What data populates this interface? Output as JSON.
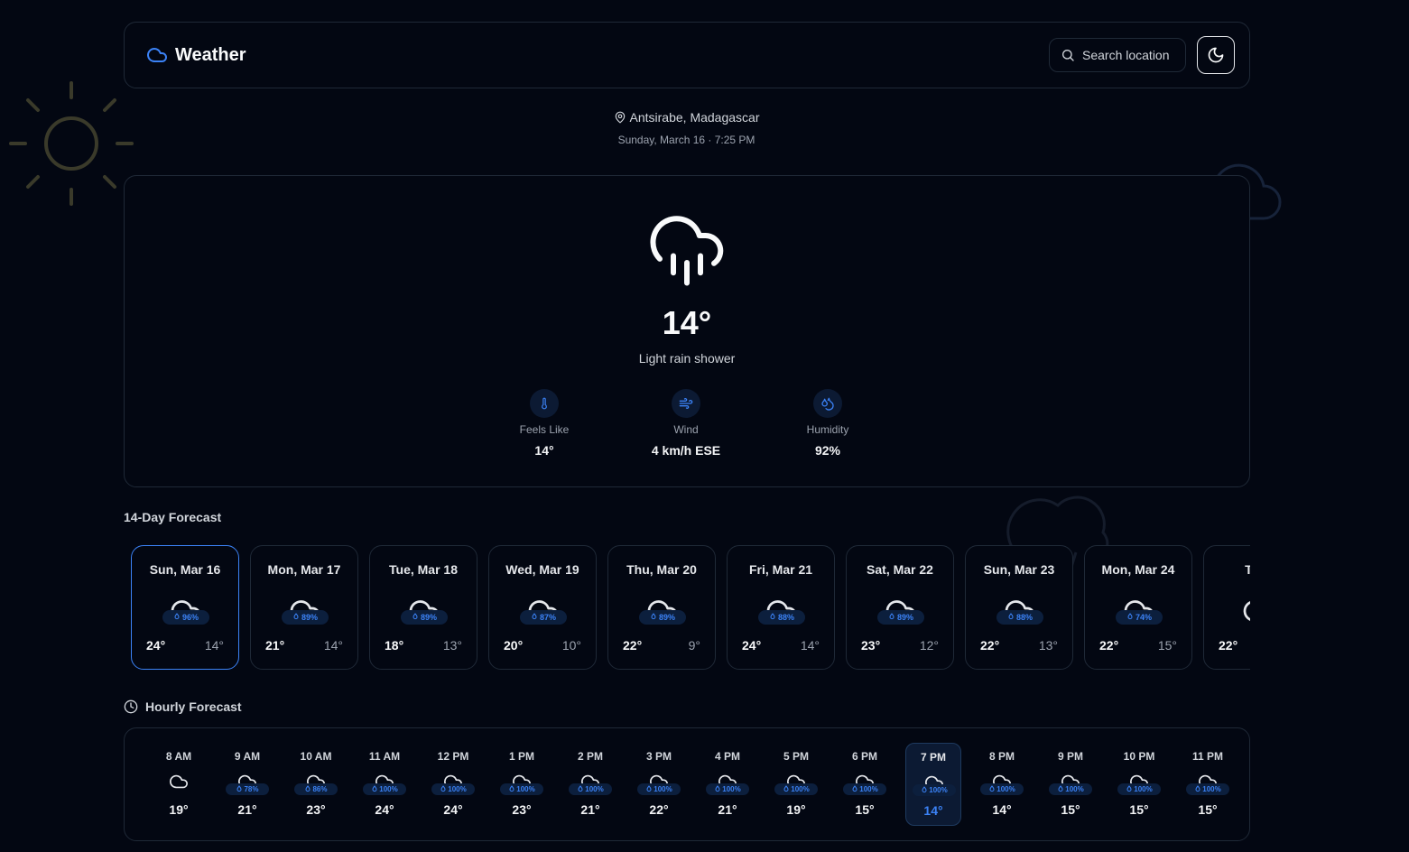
{
  "header": {
    "title": "Weather",
    "search_label": "Search location"
  },
  "location": {
    "name": "Antsirabe, Madagascar",
    "datetime": "Sunday, March 16 · 7:25 PM"
  },
  "current": {
    "temperature": "14°",
    "condition": "Light rain shower",
    "stats": [
      {
        "label": "Feels Like",
        "value": "14°",
        "icon": "thermometer-icon"
      },
      {
        "label": "Wind",
        "value": "4 km/h ESE",
        "icon": "wind-icon"
      },
      {
        "label": "Humidity",
        "value": "92%",
        "icon": "droplets-icon"
      }
    ]
  },
  "daily": {
    "title": "14-Day Forecast",
    "days": [
      {
        "name": "Sun, Mar 16",
        "precip": "96%",
        "max": "24°",
        "min": "14°",
        "selected": true
      },
      {
        "name": "Mon, Mar 17",
        "precip": "89%",
        "max": "21°",
        "min": "14°"
      },
      {
        "name": "Tue, Mar 18",
        "precip": "89%",
        "max": "18°",
        "min": "13°"
      },
      {
        "name": "Wed, Mar 19",
        "precip": "87%",
        "max": "20°",
        "min": "10°"
      },
      {
        "name": "Thu, Mar 20",
        "precip": "89%",
        "max": "22°",
        "min": "9°"
      },
      {
        "name": "Fri, Mar 21",
        "precip": "88%",
        "max": "24°",
        "min": "14°"
      },
      {
        "name": "Sat, Mar 22",
        "precip": "89%",
        "max": "23°",
        "min": "12°"
      },
      {
        "name": "Sun, Mar 23",
        "precip": "88%",
        "max": "22°",
        "min": "13°"
      },
      {
        "name": "Mon, Mar 24",
        "precip": "74%",
        "max": "22°",
        "min": "15°"
      },
      {
        "name": "Tue,",
        "precip": "",
        "max": "22°",
        "min": ""
      }
    ]
  },
  "hourly": {
    "title": "Hourly Forecast",
    "hours": [
      {
        "time": "8 AM",
        "precip": "",
        "temp": "19°"
      },
      {
        "time": "9 AM",
        "precip": "78%",
        "temp": "21°"
      },
      {
        "time": "10 AM",
        "precip": "86%",
        "temp": "23°"
      },
      {
        "time": "11 AM",
        "precip": "100%",
        "temp": "24°"
      },
      {
        "time": "12 PM",
        "precip": "100%",
        "temp": "24°"
      },
      {
        "time": "1 PM",
        "precip": "100%",
        "temp": "23°"
      },
      {
        "time": "2 PM",
        "precip": "100%",
        "temp": "21°"
      },
      {
        "time": "3 PM",
        "precip": "100%",
        "temp": "22°"
      },
      {
        "time": "4 PM",
        "precip": "100%",
        "temp": "21°"
      },
      {
        "time": "5 PM",
        "precip": "100%",
        "temp": "19°"
      },
      {
        "time": "6 PM",
        "precip": "100%",
        "temp": "15°"
      },
      {
        "time": "7 PM",
        "precip": "100%",
        "temp": "14°",
        "current": true
      },
      {
        "time": "8 PM",
        "precip": "100%",
        "temp": "14°"
      },
      {
        "time": "9 PM",
        "precip": "100%",
        "temp": "15°"
      },
      {
        "time": "10 PM",
        "precip": "100%",
        "temp": "15°"
      },
      {
        "time": "11 PM",
        "precip": "100%",
        "temp": "15°"
      }
    ]
  },
  "colors": {
    "background": "#030712",
    "accent": "#3b82f6",
    "border": "#1f2937"
  }
}
